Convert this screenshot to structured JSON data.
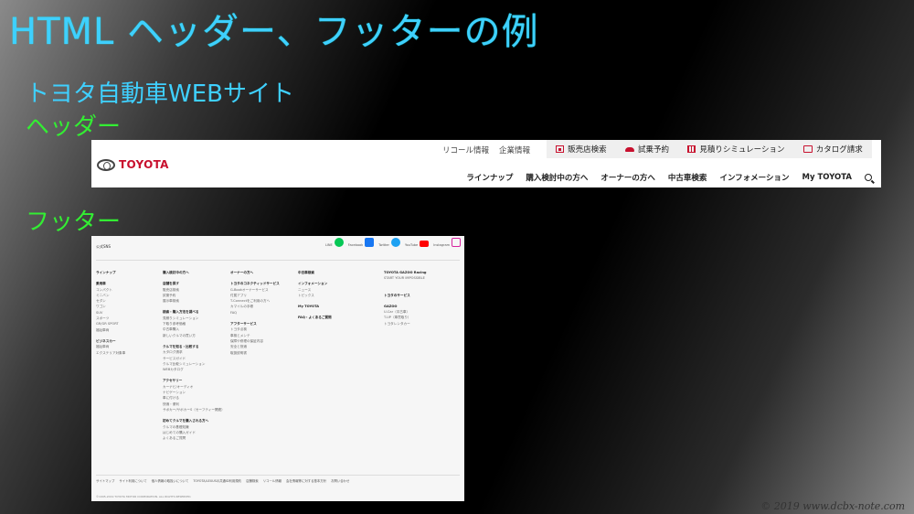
{
  "slide": {
    "title": "HTML ヘッダー、フッターの例",
    "section": "トヨタ自動車WEBサイト",
    "header_label": "ヘッダー",
    "footer_label": "フッター",
    "watermark": "© 2019 www.dcbx-note.com",
    "colors": {
      "title": "#3fd0ff",
      "label": "#33ee33"
    }
  },
  "header": {
    "logo_text": "TOYOTA",
    "util_links": [
      "リコール情報",
      "企業情報"
    ],
    "util_items": [
      {
        "icon": "shop-icon",
        "label": "販売店検索"
      },
      {
        "icon": "car-icon",
        "label": "試乗予約"
      },
      {
        "icon": "calculator-icon",
        "label": "見積りシミュレーション"
      },
      {
        "icon": "catalog-icon",
        "label": "カタログ請求"
      }
    ],
    "nav": [
      "ラインナップ",
      "購入検討中の方へ",
      "オーナーの方へ",
      "中古車検索",
      "インフォメーション",
      "My TOYOTA"
    ],
    "brand_color": "#c8102e"
  },
  "footer": {
    "sns_label": "公式SNS",
    "sns": [
      "LINE",
      "Facebook",
      "Twitter",
      "YouTube",
      "Instagram"
    ],
    "col1": [
      "ラインナップ",
      "",
      "乗用車",
      "コンパクト",
      "ミニバン",
      "セダン",
      "ワゴン",
      "SUV",
      "スポーツ",
      "GR/GR SPORT",
      "福祉車両",
      "",
      "ビジネスカー",
      "福祉車両",
      "エクステリア対象車"
    ],
    "col2": [
      "購入検討中の方へ",
      "",
      "店舗を探す",
      "販売店検索",
      "試乗予約",
      "展示車検索",
      "",
      "検索・購入方法を調べる",
      "見積りシミュレーション",
      "下取り参考価格",
      "中古車購入",
      "新しいクルマの買い方",
      "",
      "クルマを知る・比較する",
      "カタログ請求",
      "サービスガイド",
      "クルマ比較シミュレーション",
      "WEBカタログ",
      "",
      "アクセサリー",
      "カーナビ/オーディオ",
      "ナビゲーション",
      "車に付ける",
      "快適・便利",
      "サポカー/サポカーS（セーフティー関連）",
      "",
      "初めてクルマを購入される方へ",
      "クルマの基礎知識",
      "はじめての購入ガイド",
      "よくあるご質問"
    ],
    "col3": [
      "オーナーの方へ",
      "",
      "トヨタのコネクティッドサービス",
      "G-Bookオーナーサービス",
      "付属アプリ",
      "T-Connectをご利用の方へ",
      "カマイルの手帳",
      "FAQ",
      "",
      "アフターサービス",
      "トヨタ点検",
      "車検とメンテ",
      "保障や修理の保証内容",
      "安全と快適",
      "取扱説明書"
    ],
    "col4": [
      "中古車検索",
      "",
      "インフォメーション",
      "ニュース",
      "トピックス",
      "",
      "My TOYOTA",
      "",
      "FAQ・よくあるご質問"
    ],
    "col5": [
      "TOYOTA GAZOO Racing",
      "START YOUR IMPOSSIBLE",
      "",
      "",
      "トヨタのサービス",
      "",
      "GAZOO",
      "U-Car（中古車）",
      "T-UP（車買取り）",
      "トヨタレンタカー"
    ],
    "bottom_links": [
      "サイトマップ",
      "サイト利用について",
      "個人情報の取扱いについて",
      "TOYOTA/LEXUSの共通ID利用規約",
      "店舗検索",
      "リコール情報",
      "会社情報等に対する基本方針",
      "お問い合わせ"
    ],
    "copyright": "©1995-2019 TOYOTA MOTOR CORPORATION. ALL RIGHTS RESERVED."
  }
}
